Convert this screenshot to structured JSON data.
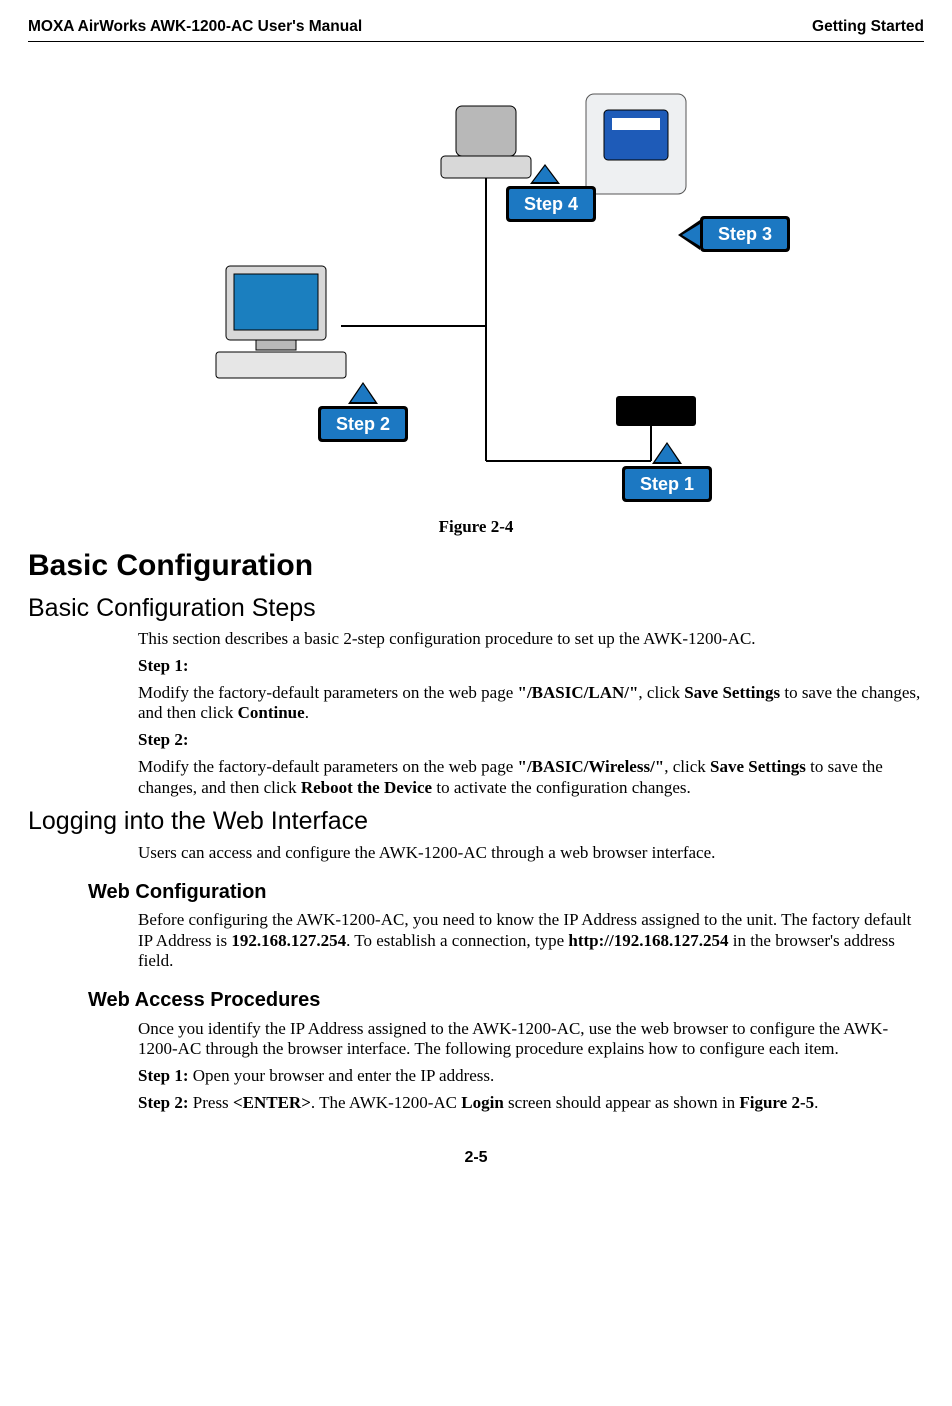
{
  "header": {
    "left": "MOXA AirWorks AWK-1200-AC User's Manual",
    "right": "Getting Started"
  },
  "figure": {
    "caption": "Figure 2-4",
    "labels": {
      "step1": "Step 1",
      "step2": "Step 2",
      "step3": "Step 3",
      "step4": "Step 4"
    }
  },
  "h1_basic": "Basic Configuration",
  "h2_steps": "Basic Configuration Steps",
  "steps_intro": "This section describes a basic 2-step configuration procedure to set up the AWK-1200-AC.",
  "step1": {
    "label": "Step 1:",
    "pre": "Modify the factory-default parameters on the web page ",
    "path": "\"/BASIC/LAN/\"",
    "mid1": ", click ",
    "save": "Save Settings",
    "mid2": " to save the changes, and then click ",
    "cont": "Continue",
    "post": "."
  },
  "step2": {
    "label": "Step 2:",
    "pre": "Modify the factory-default parameters on the web page ",
    "path": "\"/BASIC/Wireless/\"",
    "mid1": ", click ",
    "save": "Save Settings",
    "mid2": " to save the changes, and then click ",
    "reboot": "Reboot the Device",
    "post": " to activate the configuration changes."
  },
  "h2_logging": "Logging into the Web Interface",
  "logging_intro": "Users can access and configure the AWK-1200-AC through a web browser interface.",
  "h3_webconf": "Web Configuration",
  "webconf": {
    "pre": "Before configuring the AWK-1200-AC, you need to know the IP Address assigned to the unit. The factory default IP Address is ",
    "ip": "192.168.127.254",
    "mid": ". To establish a connection, type ",
    "url": "http://192.168.127.254",
    "post": " in the browser's address field."
  },
  "h3_webaccess": "Web Access Procedures",
  "webaccess_intro": "Once you identify the IP Address assigned to the AWK-1200-AC, use the web browser to configure the AWK-1200-AC through the browser interface. The following procedure explains how to configure each item.",
  "wa_step1": {
    "label": "Step 1:",
    "text": " Open your browser and enter the IP address."
  },
  "wa_step2": {
    "label": "Step 2:",
    "t1": " Press ",
    "enter": "<ENTER>",
    "t2": ". The AWK-1200-AC ",
    "login": "Login",
    "t3": " screen should appear as shown in ",
    "figref": "Figure 2-5",
    "t4": "."
  },
  "page_num": "2-5"
}
